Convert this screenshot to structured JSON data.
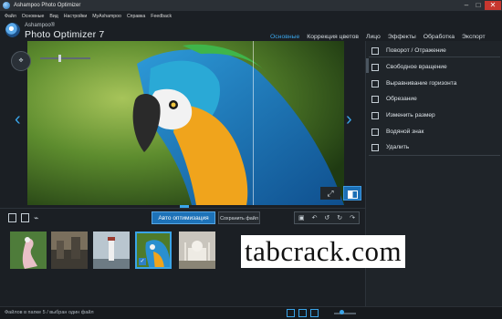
{
  "window": {
    "title": "Ashampoo Photo Optimizer",
    "controls": [
      "–",
      "□",
      "✕"
    ]
  },
  "menu": [
    "Файл",
    "Основные",
    "Вид",
    "Настройки",
    "MyAshampoo",
    "Справка",
    "Feedback"
  ],
  "header": {
    "brand_small": "Ashampoo®",
    "brand_large": "Photo Optimizer 7"
  },
  "tabs": [
    {
      "label": "Основные",
      "active": true
    },
    {
      "label": "Коррекция цветов",
      "active": false
    },
    {
      "label": "Лицо",
      "active": false
    },
    {
      "label": "Эффекты",
      "active": false
    },
    {
      "label": "Обработка",
      "active": false
    },
    {
      "label": "Экспорт",
      "active": false
    }
  ],
  "side_panel": {
    "items": [
      {
        "label": "Поворот / Отражение",
        "icon": "rotate-icon"
      },
      {
        "label": "Свободное вращение",
        "icon": "free-rotate-icon"
      },
      {
        "label": "Выравнивание горизонта",
        "icon": "horizon-icon"
      },
      {
        "label": "Обрезание",
        "icon": "crop-icon"
      },
      {
        "label": "Изменить размер",
        "icon": "resize-icon"
      },
      {
        "label": "Водяной знак",
        "icon": "watermark-icon"
      },
      {
        "label": "Удалить",
        "icon": "trash-icon"
      }
    ]
  },
  "toolbar": {
    "auto_optimize": "Авто оптимизация",
    "save_file": "Сохранить файл"
  },
  "filmstrip": {
    "thumbnails": [
      {
        "name": "flamingo",
        "selected": false,
        "checked": false
      },
      {
        "name": "city",
        "selected": false,
        "checked": false
      },
      {
        "name": "lighthouse",
        "selected": false,
        "checked": false
      },
      {
        "name": "parrot",
        "selected": true,
        "checked": true
      },
      {
        "name": "taj-mahal",
        "selected": false,
        "checked": false
      }
    ]
  },
  "status": {
    "text": "Файлов в папке 5 / выбран один файл"
  },
  "watermark": {
    "text": "tabcrack.com"
  },
  "colors": {
    "accent": "#3aa4e8",
    "background": "#1b1f24",
    "close": "#c7372f"
  }
}
